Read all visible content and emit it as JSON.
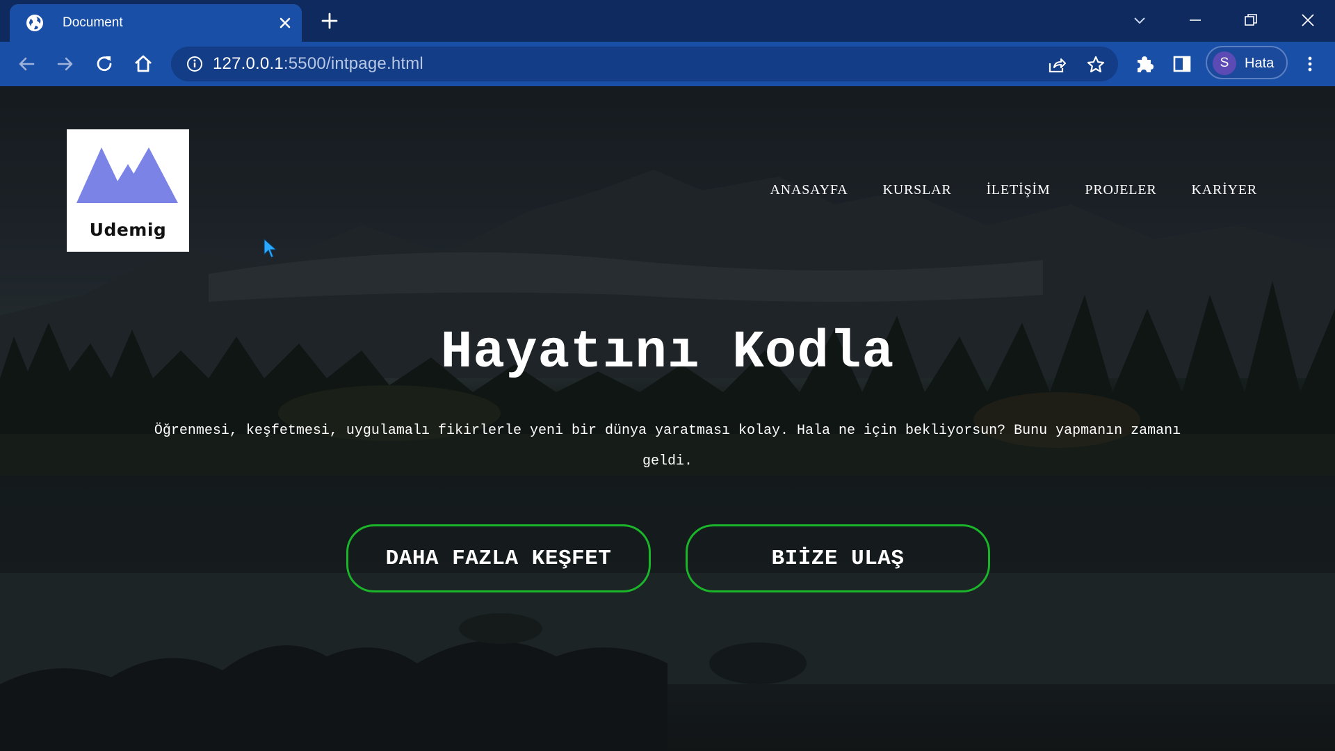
{
  "browser": {
    "tab_title": "Document",
    "url_host": "127.0.0.1",
    "url_rest": ":5500/intpage.html",
    "profile_initial": "S",
    "profile_label": "Hata"
  },
  "logo": {
    "text": "Udemig",
    "mark_color": "#7b83e6"
  },
  "nav": {
    "items": [
      {
        "label": "ANASAYFA"
      },
      {
        "label": "KURSLAR"
      },
      {
        "label": "İLETİŞİM"
      },
      {
        "label": "PROJELER"
      },
      {
        "label": "KARİYER"
      }
    ]
  },
  "hero": {
    "title": "Hayatını Kodla",
    "subtitle": "Öğrenmesi, keşfetmesi, uygulamalı fikirlerle yeni bir dünya yaratması kolay. Hala ne için bekliyorsun? Bunu yapmanın zamanı geldi."
  },
  "buttons": {
    "explore": "DAHA FAZLA KEŞFET",
    "contact": "BIİZE ULAŞ",
    "border_color": "#1bb52a"
  },
  "icons": {
    "favicon": "globe-icon",
    "tab_close": "close-icon",
    "new_tab": "plus-icon",
    "back": "arrow-left-icon",
    "forward": "arrow-right-icon",
    "reload": "reload-icon",
    "home": "home-icon",
    "site_info": "info-icon",
    "share": "share-icon",
    "bookmark": "star-icon",
    "extensions": "puzzle-icon",
    "side_panel": "side-panel-icon",
    "menu": "kebab-menu-icon"
  }
}
